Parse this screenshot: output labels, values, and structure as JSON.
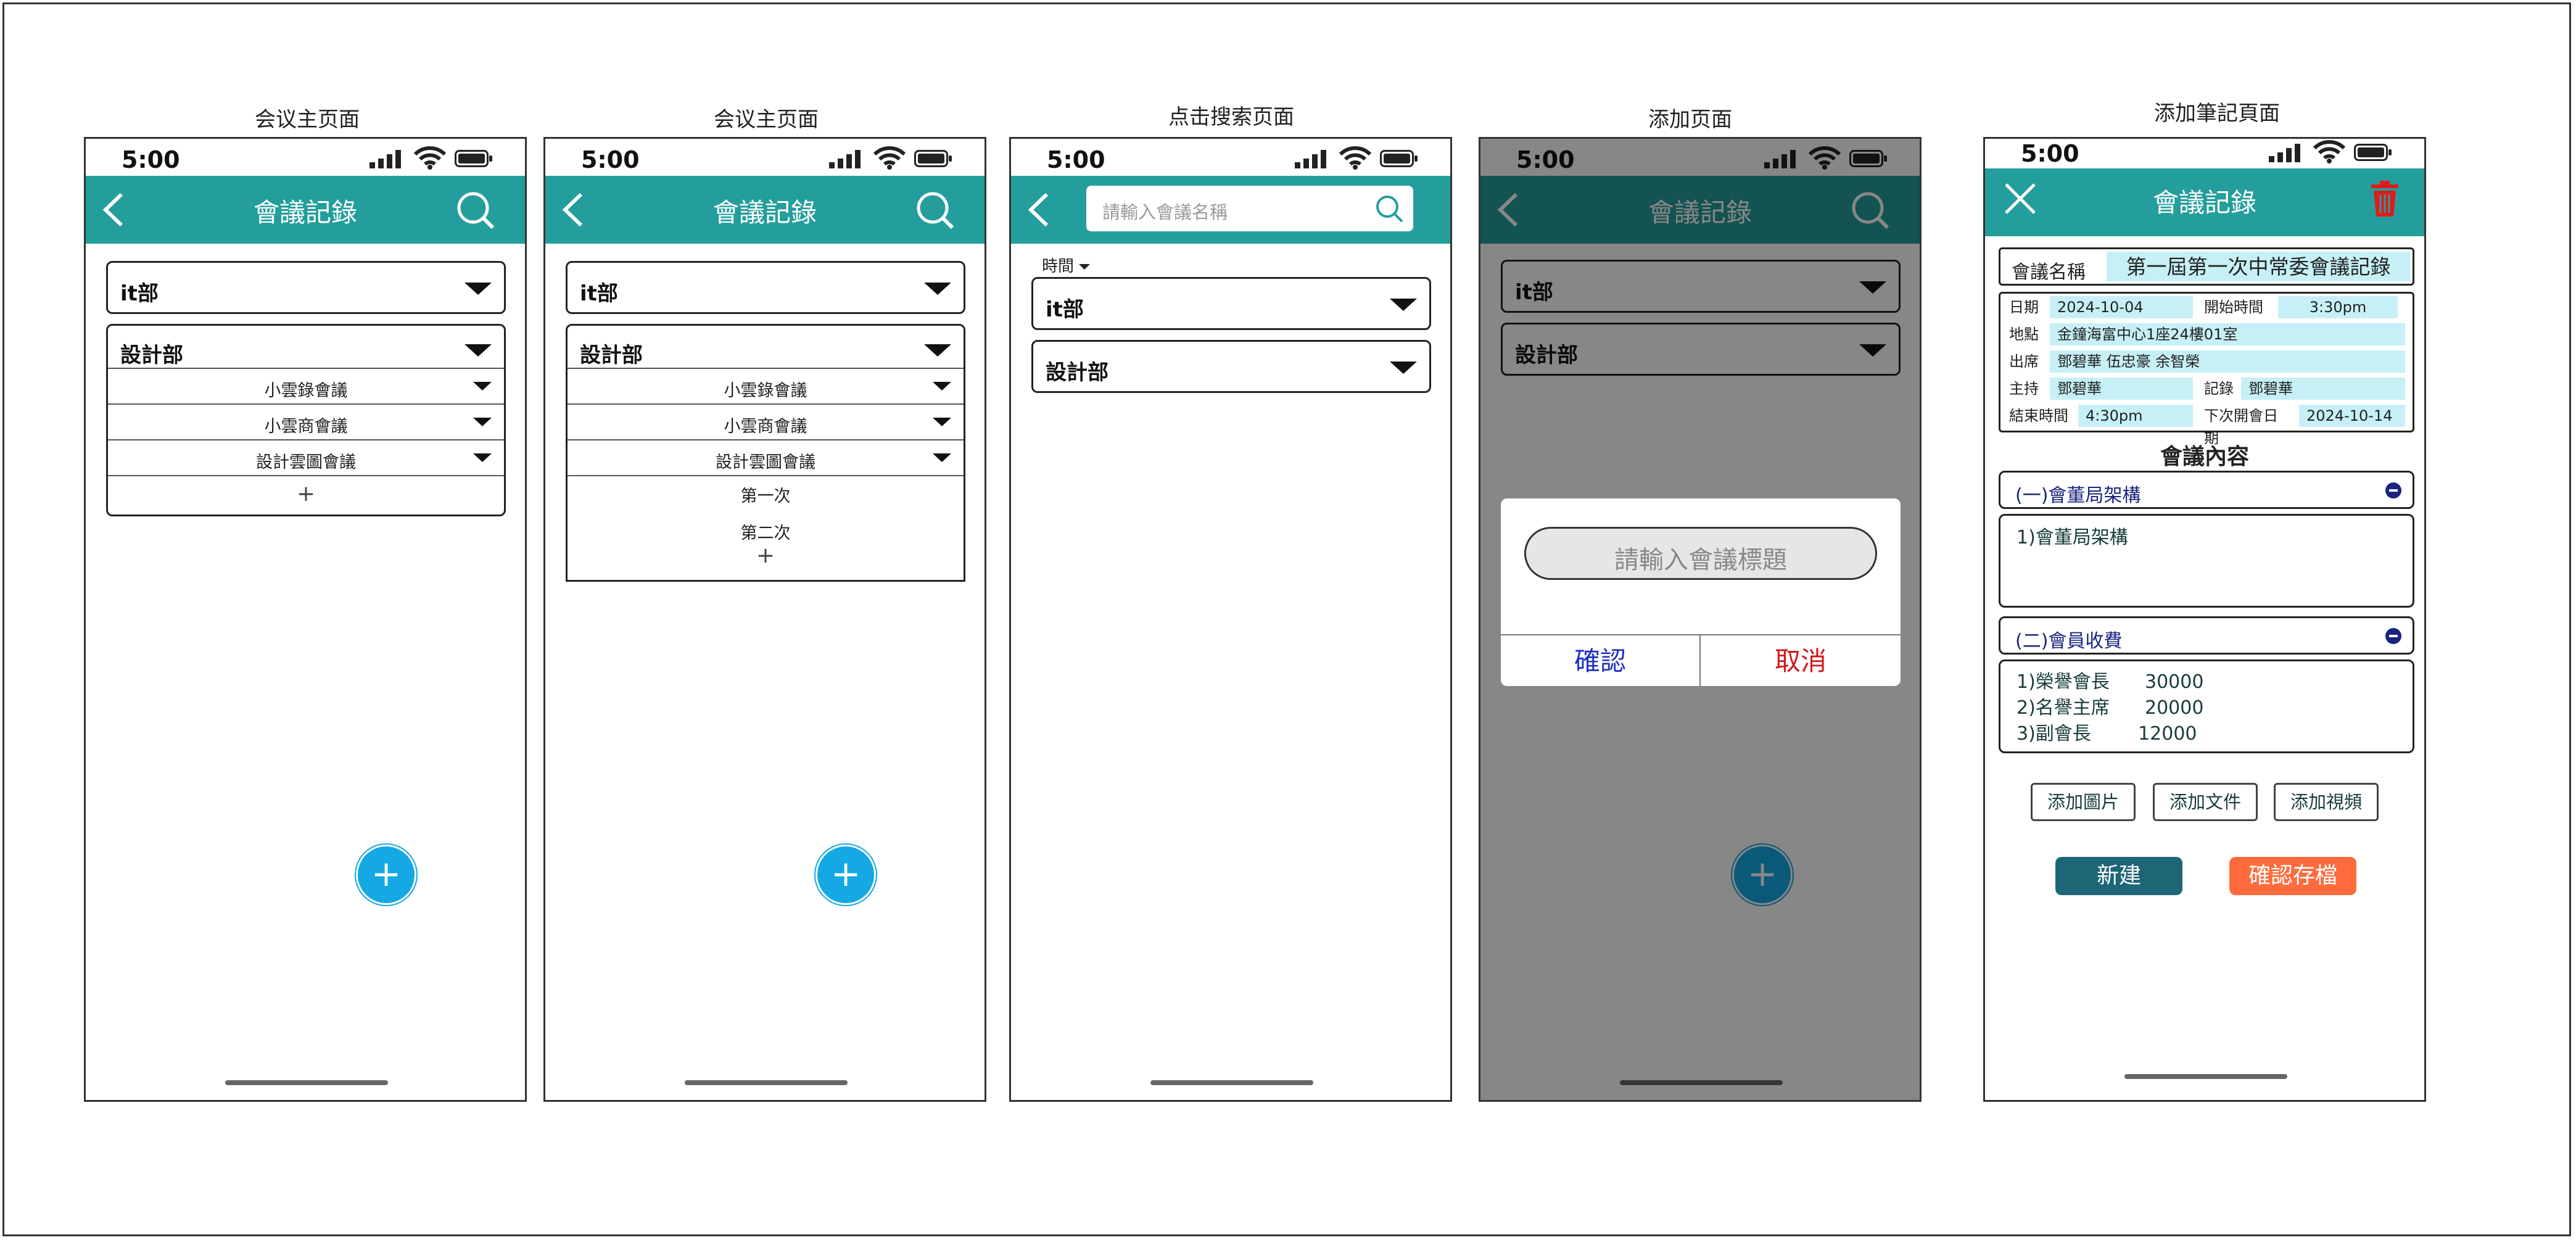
{
  "common": {
    "time": "5:00",
    "app_title": "會議記錄",
    "fab_label": "+",
    "plus": "+"
  },
  "captions": [
    "会议主页面",
    "会议主页面",
    "点击搜索页面",
    "添加页面",
    "添加筆記頁面"
  ],
  "departments": {
    "it": "it部",
    "design": "設計部",
    "design_items": [
      "小雲錄會議",
      "小雲商會議",
      "設計雲圖會議"
    ],
    "expanded_items": [
      "第一次",
      "第二次"
    ]
  },
  "search_page": {
    "placeholder": "請輸入會議名稱",
    "time_filter": "時間"
  },
  "add_dialog": {
    "placeholder": "請輸入會議標題",
    "confirm": "確認",
    "cancel": "取消"
  },
  "note_page": {
    "name_label": "會議名稱",
    "name_value": "第一屆第一次中常委會議記錄",
    "date_label": "日期",
    "date_value": "2024-10-04",
    "start_label": "開始時間",
    "start_value": "3:30pm",
    "place_label": "地點",
    "place_value": "金鐘海富中心1座24樓01室",
    "attend_label": "出席",
    "attend_value": "鄧碧華 伍忠豪 余智榮",
    "host_label": "主持",
    "host_value": "鄧碧華",
    "record_label": "記錄",
    "record_value": "鄧碧華",
    "end_label": "結束時間",
    "end_value": "4:30pm",
    "next_label": "下次開會日期",
    "next_value": "2024-10-14",
    "content_title": "會議內容",
    "section1_title": "(一)會董局架構",
    "section1_lines": [
      "1)會董局架構"
    ],
    "section2_title": "(二)會員收費",
    "section2_lines": [
      "1)榮譽會長      30000",
      "2)名譽主席      20000",
      "3)副會長        12000"
    ],
    "add_image": "添加圖片",
    "add_file": "添加文件",
    "add_video": "添加視頻",
    "new_btn": "新建",
    "save_btn": "確認存檔"
  },
  "colors": {
    "teal": "#249e9c",
    "fab": "#14a8e4",
    "cell": "#c6f0f6",
    "new_btn": "#1e6676",
    "save_btn": "#ff6b3d",
    "trash": "#e01b1b"
  }
}
